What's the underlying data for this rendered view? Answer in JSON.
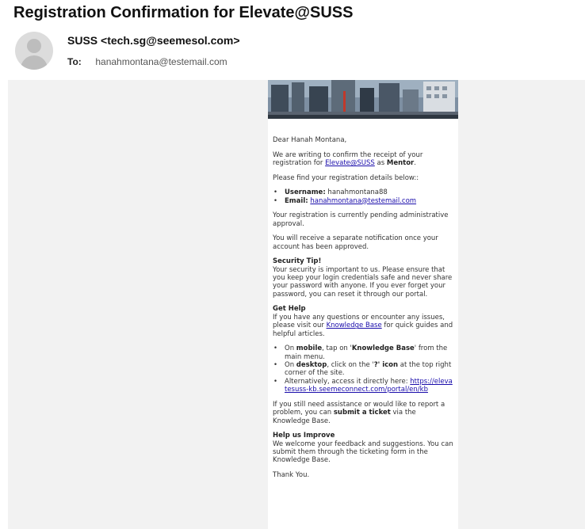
{
  "email": {
    "subject": "Registration Confirmation for Elevate@SUSS",
    "from": "SUSS <tech.sg@seemesol.com>",
    "to_label": "To:",
    "to_value": "hanahmontana@testemail.com"
  },
  "body": {
    "greeting": "Dear Hanah Montana,",
    "p1_pre": "We are writing to confirm the receipt of your registration for ",
    "p1_link": "Elevate@SUSS",
    "p1_mid": " as ",
    "p1_role": "Mentor",
    "p1_end": ".",
    "p2": "Please find your registration details below::",
    "username_label": "Username:",
    "username_value": " hanahmontana88",
    "email_label": "Email:",
    "email_value": "hanahmontana@testemail.com",
    "p3": "Your registration is currently pending administrative approval.",
    "p4": "You will receive a separate notification once your account has been approved.",
    "security_title": "Security Tip!",
    "security_text": "Your security is important to us. Please ensure that you keep your login credentials safe and never share your password with anyone. If you ever forget your password, you can reset it through our portal.",
    "help_title": "Get Help",
    "help_pre": "If you have any questions or encounter any issues, please visit our ",
    "help_link": "Knowledge Base",
    "help_post": " for quick guides and helpful articles.",
    "li1_a": "On ",
    "li1_b": "mobile",
    "li1_c": ", tap on '",
    "li1_d": "Knowledge Base",
    "li1_e": "' from the main menu.",
    "li2_a": "On ",
    "li2_b": "desktop",
    "li2_c": ", click on the '",
    "li2_d": "?' icon",
    "li2_e": " at the top right corner of the site.",
    "li3_a": "Alternatively, access it directly here: ",
    "li3_link": "https://elevatesuss-kb.seemeconnect.com/portal/en/kb",
    "p5_pre": "If you still need assistance or would like to report a problem, you can ",
    "p5_bold": "submit a ticket",
    "p5_post": " via the Knowledge Base.",
    "improve_title": "Help us Improve",
    "improve_text": "We welcome your feedback and suggestions. You can submit them through the ticketing form in the Knowledge Base.",
    "thanks": "Thank You."
  }
}
